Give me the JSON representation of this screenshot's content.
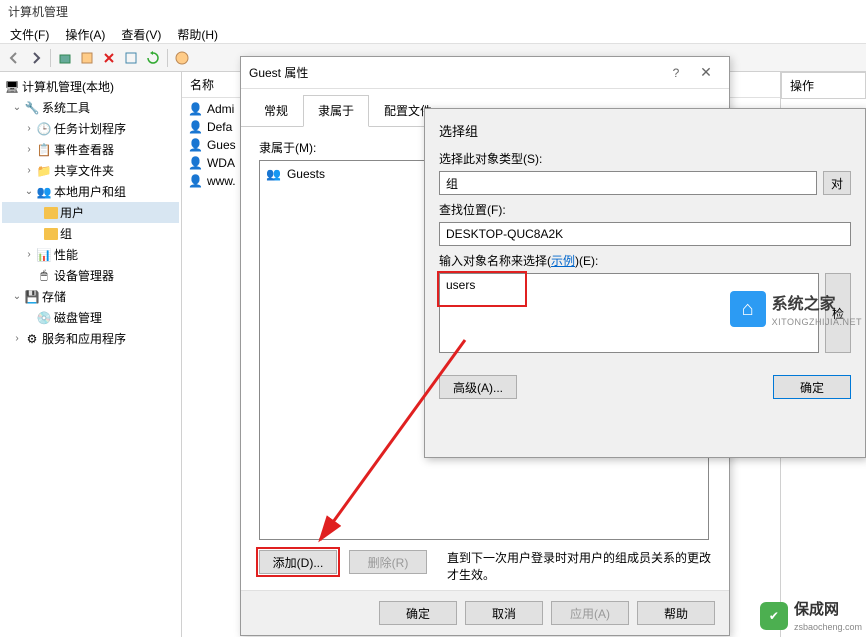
{
  "window": {
    "title": "计算机管理"
  },
  "menu": {
    "file": "文件(F)",
    "action": "操作(A)",
    "view": "查看(V)",
    "help": "帮助(H)"
  },
  "tree": {
    "root": "计算机管理(本地)",
    "sys_tools": "系统工具",
    "task_sched": "任务计划程序",
    "event_viewer": "事件查看器",
    "shared_folders": "共享文件夹",
    "local_users": "本地用户和组",
    "users": "用户",
    "groups": "组",
    "perf": "性能",
    "dev_mgr": "设备管理器",
    "storage": "存储",
    "disk_mgmt": "磁盘管理",
    "services": "服务和应用程序"
  },
  "list": {
    "header": "名称",
    "items": [
      "Admi",
      "Defa",
      "Gues",
      "WDA",
      "www."
    ]
  },
  "actions": {
    "header": "操作"
  },
  "guest_dialog": {
    "title": "Guest 属性",
    "tabs": {
      "general": "常规",
      "member_of": "隶属于",
      "profile": "配置文件"
    },
    "member_label": "隶属于(M):",
    "member_item": "Guests",
    "add": "添加(D)...",
    "remove": "删除(R)",
    "note": "直到下一次用户登录时对用户的组成员关系的更改才生效。",
    "ok": "确定",
    "cancel": "取消",
    "apply": "应用(A)",
    "help": "帮助"
  },
  "select_dialog": {
    "title": "选择组",
    "obj_type_label": "选择此对象类型(S):",
    "obj_type_value": "组",
    "obj_type_btn": "对",
    "location_label": "查找位置(F):",
    "location_value": "DESKTOP-QUC8A2K",
    "names_label_prefix": "输入对象名称来选择(",
    "names_label_link": "示例",
    "names_label_suffix": ")(E):",
    "names_value": "users",
    "check_btn": "检",
    "advanced": "高级(A)...",
    "ok": "确定"
  },
  "watermark1": {
    "name": "系统之家",
    "url": "XITONGZHIJIA.NET"
  },
  "watermark2": {
    "name": "保成网",
    "url": "zsbaocheng.com"
  }
}
